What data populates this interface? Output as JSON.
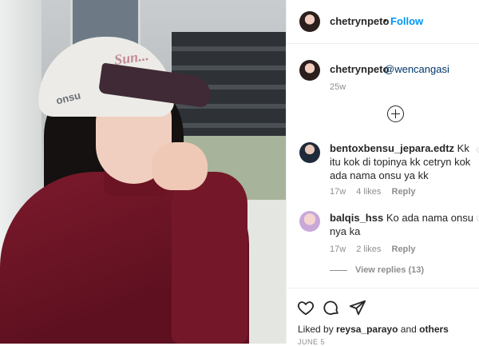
{
  "post": {
    "author": "chetrynpeto",
    "follow_label": "Follow",
    "separator": "•"
  },
  "photo": {
    "cap_text_front": "Sun...",
    "cap_text_side": "onsu"
  },
  "caption": {
    "author": "chetrynpeto",
    "mention": "@wencangasi",
    "time": "25w"
  },
  "comments": [
    {
      "author": "bentoxbensu_jepara.edtz",
      "text": "Kk itu kok di topinya kk cetryn kok ada nama onsu ya kk",
      "time": "17w",
      "likes": "4 likes",
      "reply": "Reply"
    },
    {
      "author": "balqis_hss",
      "text": "Ko ada nama onsu nya ka",
      "time": "17w",
      "likes": "2 likes",
      "reply": "Reply"
    }
  ],
  "view_replies": "View replies (13)",
  "liked_by": {
    "prefix": "Liked by",
    "user": "reysa_parayo",
    "and": "and",
    "others": "others"
  },
  "date": "JUNE 5",
  "colors": {
    "link": "#0095f6",
    "mention": "#00376b",
    "muted": "#8e8e8e"
  },
  "icons": [
    "heart-icon",
    "comment-icon",
    "share-icon",
    "add-comment-icon"
  ]
}
